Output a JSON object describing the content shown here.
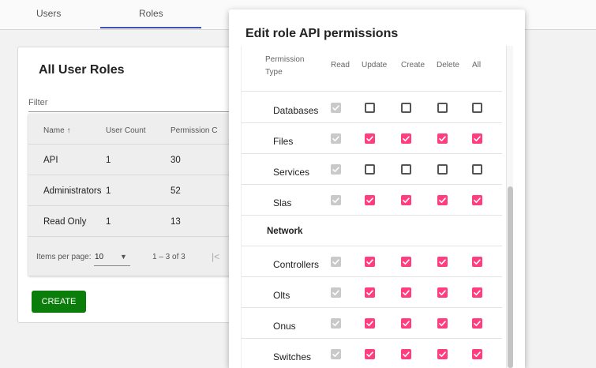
{
  "tabs": [
    {
      "label": "Users"
    },
    {
      "label": "Roles"
    }
  ],
  "card": {
    "title": "All User Roles",
    "filter_label": "Filter",
    "columns": [
      "Name ↑",
      "User Count",
      "Permission C"
    ],
    "rows": [
      {
        "name": "API",
        "user_count": "1",
        "permission_count": "30"
      },
      {
        "name": "Administrators",
        "user_count": "1",
        "permission_count": "52"
      },
      {
        "name": "Read Only",
        "user_count": "1",
        "permission_count": "13"
      }
    ],
    "paginator": {
      "items_per_page_label": "Items per page:",
      "page_size": "10",
      "range": "1 – 3 of 3"
    },
    "create_label": "CREATE"
  },
  "dialog": {
    "title": "Edit role API permissions",
    "headers": {
      "type": "Permission Type",
      "read": "Read",
      "update": "Update",
      "create": "Create",
      "delete": "Delete",
      "all": "All"
    },
    "rows": [
      {
        "name": "Databases",
        "section": false,
        "read": "disabled",
        "update": "empty",
        "create": "empty",
        "delete": "empty",
        "all": "empty"
      },
      {
        "name": "Files",
        "section": false,
        "read": "disabled",
        "update": "checked",
        "create": "checked",
        "delete": "checked",
        "all": "checked"
      },
      {
        "name": "Services",
        "section": false,
        "read": "disabled",
        "update": "empty",
        "create": "empty",
        "delete": "empty",
        "all": "empty"
      },
      {
        "name": "Slas",
        "section": false,
        "read": "disabled",
        "update": "checked",
        "create": "checked",
        "delete": "checked",
        "all": "checked"
      },
      {
        "name": "Network",
        "section": true
      },
      {
        "name": "Controllers",
        "section": false,
        "read": "disabled",
        "update": "checked",
        "create": "checked",
        "delete": "checked",
        "all": "checked"
      },
      {
        "name": "Olts",
        "section": false,
        "read": "disabled",
        "update": "checked",
        "create": "checked",
        "delete": "checked",
        "all": "checked"
      },
      {
        "name": "Onus",
        "section": false,
        "read": "disabled",
        "update": "checked",
        "create": "checked",
        "delete": "checked",
        "all": "checked"
      },
      {
        "name": "Switches",
        "section": false,
        "read": "disabled",
        "update": "checked",
        "create": "checked",
        "delete": "checked",
        "all": "checked"
      }
    ]
  },
  "colors": {
    "accent": "#3f51b5",
    "checked": "#ff3d7f",
    "create_button": "#0b7d0b",
    "disabled": "#c9c9c9"
  },
  "icons": {
    "sort": "arrow-up-icon",
    "dropdown": "caret-down-icon",
    "first_page": "first-page-icon",
    "check": "check-icon"
  }
}
